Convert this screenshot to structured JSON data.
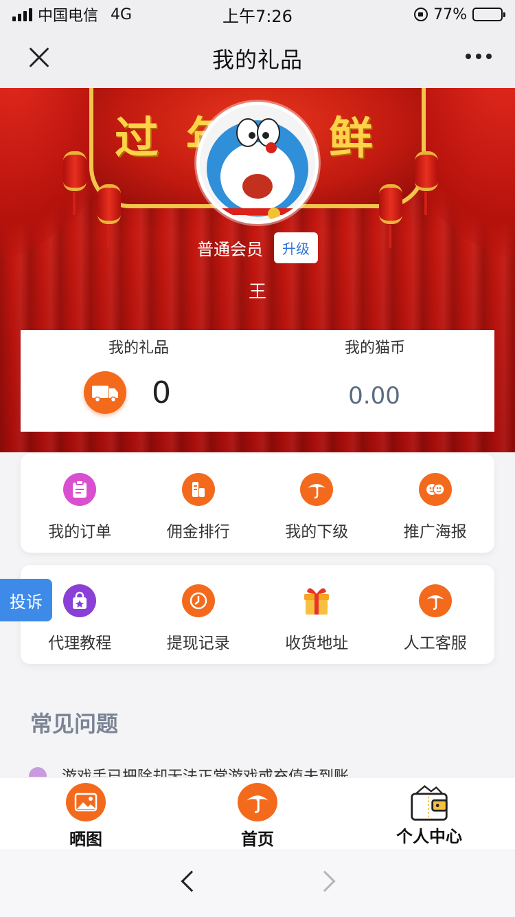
{
  "status_bar": {
    "carrier": "中国电信",
    "network": "4G",
    "time": "上午7:26",
    "battery": "77%",
    "battery_level": 0.77
  },
  "nav": {
    "title": "我的礼品"
  },
  "profile": {
    "member_label": "普通会员",
    "upgrade_label": "升级",
    "username": "王",
    "banner_text": "过年新鲜"
  },
  "stats": {
    "gifts_label": "我的礼品",
    "gifts_value": "0",
    "coins_label": "我的猫币",
    "coins_value": "0.00"
  },
  "menu_row1": [
    {
      "label": "我的订单",
      "icon": "order-clipboard-icon",
      "color": "#d84fcf"
    },
    {
      "label": "佣金排行",
      "icon": "ranking-icon",
      "color": "#f36a1d"
    },
    {
      "label": "我的下级",
      "icon": "umbrella-logo-icon",
      "color": "#f36a1d"
    },
    {
      "label": "推广海报",
      "icon": "poster-faces-icon",
      "color": "#f36a1d"
    }
  ],
  "menu_row2": [
    {
      "label": "代理教程",
      "icon": "bag-star-icon",
      "color": "#8a3fd6"
    },
    {
      "label": "提现记录",
      "icon": "clock-icon",
      "color": "#f36a1d"
    },
    {
      "label": "收货地址",
      "icon": "gift-box-icon",
      "color": "#f5b23a"
    },
    {
      "label": "人工客服",
      "icon": "umbrella-logo-icon",
      "color": "#f36a1d"
    }
  ],
  "complaint_label": "投诉",
  "faq": {
    "heading": "常见问题",
    "items": [
      "游戏手已把除却无法正常游戏或充值未到账"
    ]
  },
  "tabbar": [
    {
      "label": "晒图",
      "icon": "image-icon"
    },
    {
      "label": "首页",
      "icon": "umbrella-logo-icon"
    },
    {
      "label": "个人中心",
      "icon": "wallet-icon",
      "active": true
    }
  ]
}
